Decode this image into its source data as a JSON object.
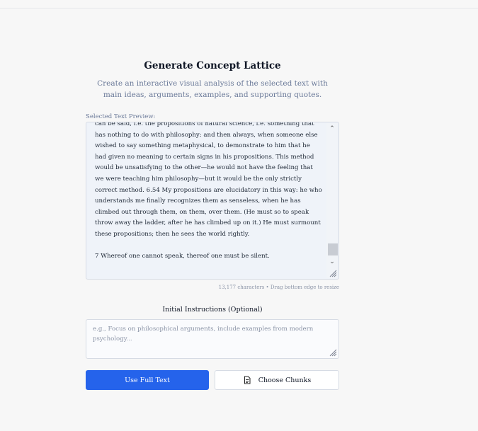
{
  "dialog": {
    "title": "Generate Concept Lattice",
    "subtitle": "Create an interactive visual analysis of the selected text with main ideas, arguments, examples, and supporting quotes."
  },
  "preview": {
    "label": "Selected Text Preview:",
    "text": "can be said, i.e. the propositions of natural science, i.e. something that has nothing to do with philosophy: and then always, when someone else wished to say something metaphysical, to demonstrate to him that he had given no meaning to certain signs in his propositions. This method would be unsatisfying to the other—he would not have the feeling that we were teaching him philosophy—but it would be the only strictly correct method. 6.54 My propositions are elucidatory in this way: he who understands me finally recognizes them as senseless, when he has climbed out through them, on them, over them. (He must so to speak throw away the ladder, after he has climbed up on it.) He must surmount these propositions; then he sees the world rightly.\n\n7 Whereof one cannot speak, thereof one must be silent.",
    "meta": "13,177 characters • Drag bottom edge to resize"
  },
  "instructions": {
    "label": "Initial Instructions (Optional)",
    "placeholder": "e.g., Focus on philosophical arguments, include examples from modern psychology...",
    "value": ""
  },
  "buttons": {
    "primary_label": "Use Full Text",
    "secondary_label": "Choose Chunks",
    "secondary_icon": "document-icon"
  },
  "colors": {
    "accent": "#2563eb",
    "subtitle": "#6b7a99",
    "preview_bg": "#eff3f9"
  }
}
